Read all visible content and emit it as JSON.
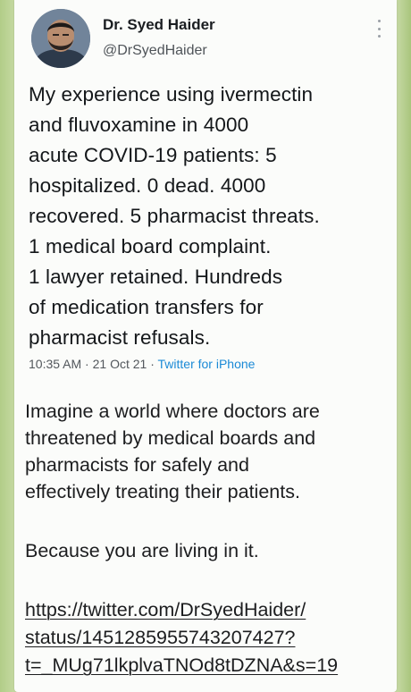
{
  "author": {
    "name": "Dr. Syed Haider",
    "handle": "@DrSyedHaider"
  },
  "tweet": {
    "lines": [
      "My experience using ivermectin",
      "and fluvoxamine in 4000",
      "acute COVID-19 patients: 5",
      "hospitalized. 0 dead. 4000",
      "recovered. 5 pharmacist threats.",
      "1 medical board complaint.",
      "1 lawyer retained. Hundreds",
      "of medication transfers for",
      "pharmacist refusals."
    ],
    "time": "10:35 AM",
    "date": "21 Oct 21",
    "separator": "·",
    "source": "Twitter for iPhone"
  },
  "message": {
    "paragraph_lines": [
      "Imagine a world where doctors are",
      "threatened by medical boards and",
      "pharmacists for safely and",
      "effectively treating their patients."
    ],
    "closing": "Because you are living in it.",
    "link_lines": [
      "https://twitter.com/DrSyedHaider/",
      "status/1451285955743207427?",
      "t=_MUg71lkplvaTNOd8tDZNA&s=19"
    ]
  },
  "colors": {
    "background": "#c6d9a4",
    "card": "#fbfcfa",
    "link_blue": "#1b8ad6",
    "text": "#14171a"
  },
  "icons": [
    "avatar-photo",
    "more-options-icon"
  ]
}
